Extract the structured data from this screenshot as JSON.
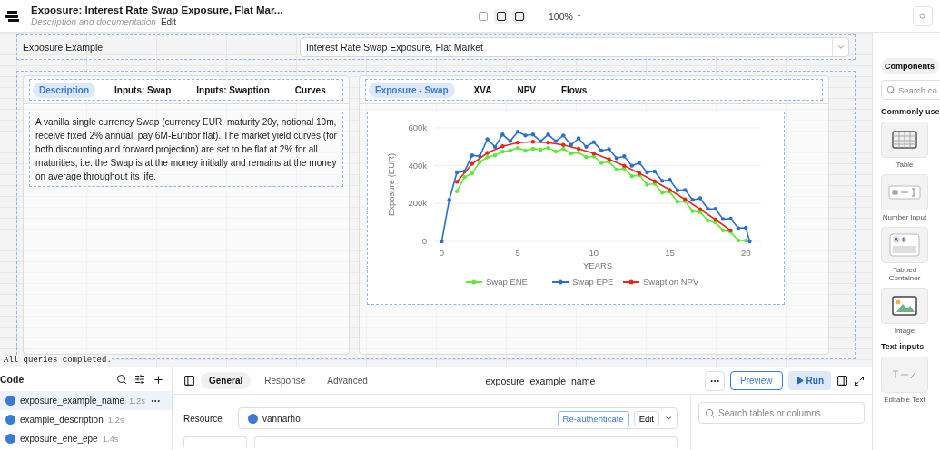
{
  "header": {
    "title": "Exposure: Interest Rate Swap Exposure, Flat Mar...",
    "subtitle": "Description and documentation",
    "edit": "Edit",
    "zoom": "100%",
    "layout_toggles": [
      {
        "selected": false
      },
      {
        "selected": true
      },
      {
        "selected": true
      }
    ]
  },
  "canvas": {
    "example_label": "Exposure Example",
    "example_select": "Interest Rate Swap Exposure, Flat Market",
    "left_tabs": [
      {
        "label": "Description",
        "selected": true
      },
      {
        "label": "Inputs: Swap",
        "selected": false
      },
      {
        "label": "Inputs: Swaption",
        "selected": false
      },
      {
        "label": "Curves",
        "selected": false
      }
    ],
    "description": "A vanilla single currency Swap (currency EUR, maturity 20y, notional 10m, receive fixed 2% annual, pay 6M-Euribor flat). The market yield curves (for both discounting and forward projection) are set to be flat at 2% for all maturities, i.e. the Swap is at the money initially and remains at the money on average throughout its life.",
    "right_tabs": [
      {
        "label": "Exposure - Swap",
        "selected": true
      },
      {
        "label": "XVA",
        "selected": false
      },
      {
        "label": "NPV",
        "selected": false
      },
      {
        "label": "Flows",
        "selected": false
      }
    ],
    "chart_data": {
      "type": "line",
      "xlabel": "YEARS",
      "ylabel": "Exposure (EUR)",
      "grid": true,
      "legend": "bottom",
      "x": [
        0,
        0.5,
        1,
        1.5,
        2,
        2.5,
        3,
        3.5,
        4,
        4.5,
        5,
        5.5,
        6,
        6.5,
        7,
        7.5,
        8,
        8.5,
        9,
        9.5,
        10,
        10.5,
        11,
        11.5,
        12,
        12.5,
        13,
        13.5,
        14,
        14.5,
        15,
        15.5,
        16,
        16.5,
        17,
        17.5,
        18,
        18.5,
        19,
        19.5,
        20,
        20.25
      ],
      "xlim": [
        -0.5,
        21
      ],
      "ylim": [
        0,
        600000
      ],
      "xticks": [
        0,
        5,
        10,
        15,
        20
      ],
      "yticks": [
        {
          "value": 0,
          "label": "0"
        },
        {
          "value": 200000,
          "label": "200k"
        },
        {
          "value": 400000,
          "label": "400k"
        },
        {
          "value": 600000,
          "label": "600k"
        }
      ],
      "series": [
        {
          "name": "Swap ENE",
          "color": "#5ee83a",
          "values": [
            null,
            null,
            265000,
            340000,
            360000,
            420000,
            445000,
            455000,
            475000,
            480000,
            495000,
            480000,
            490000,
            485000,
            495000,
            475000,
            490000,
            465000,
            470000,
            445000,
            450000,
            415000,
            420000,
            380000,
            385000,
            345000,
            350000,
            300000,
            305000,
            258000,
            262000,
            210000,
            212000,
            160000,
            155000,
            110000,
            100000,
            58000,
            50000,
            5000,
            5000,
            null
          ]
        },
        {
          "name": "Swap EPE",
          "color": "#2a6fcb",
          "values": [
            0,
            220000,
            365000,
            370000,
            455000,
            450000,
            540000,
            500000,
            565000,
            530000,
            580000,
            560000,
            565000,
            530000,
            565000,
            530000,
            560000,
            510000,
            545000,
            500000,
            525000,
            480000,
            488000,
            440000,
            450000,
            400000,
            415000,
            365000,
            370000,
            320000,
            325000,
            270000,
            272000,
            220000,
            228000,
            172000,
            172000,
            118000,
            120000,
            70000,
            72000,
            0
          ]
        },
        {
          "name": "Swaption NPV",
          "color": "#e8251b",
          "values": [
            null,
            null,
            315000,
            null,
            410000,
            null,
            468000,
            null,
            503000,
            null,
            522000,
            null,
            527000,
            null,
            522000,
            null,
            510000,
            null,
            490000,
            null,
            465000,
            null,
            435000,
            null,
            400000,
            null,
            360000,
            null,
            318000,
            null,
            272000,
            null,
            222000,
            null,
            170000,
            null,
            115000,
            null,
            58000,
            null,
            null,
            null
          ]
        }
      ]
    },
    "status": "All queries completed."
  },
  "components": {
    "tab": "Components",
    "search_placeholder": "Search co",
    "section": "Commonly use",
    "items": [
      {
        "label": "Table",
        "kind": "table"
      },
      {
        "label": "Number Input",
        "kind": "number"
      },
      {
        "label": "Tabbed Container",
        "kind": "tabbed"
      },
      {
        "label": "Image",
        "kind": "image"
      }
    ],
    "section2": "Text inputs",
    "items2": [
      {
        "label": "Editable Text",
        "kind": "editable"
      }
    ]
  },
  "code": {
    "title": "Code",
    "queries": [
      {
        "name": "exposure_example_name",
        "time": "1.2s",
        "selected": true
      },
      {
        "name": "example_description",
        "time": "1.2s",
        "selected": false
      },
      {
        "name": "exposure_ene_epe",
        "time": "1.4s",
        "selected": false
      }
    ]
  },
  "editor": {
    "tabs": [
      {
        "label": "General",
        "selected": true
      },
      {
        "label": "Response",
        "selected": false
      },
      {
        "label": "Advanced",
        "selected": false
      }
    ],
    "query_name": "exposure_example_name",
    "preview": "Preview",
    "run": "Run",
    "resource_label": "Resource",
    "resource": "vannarho",
    "reauth": "Re-authenticate",
    "edit": "Edit",
    "search_placeholder": "Search tables or columns"
  }
}
